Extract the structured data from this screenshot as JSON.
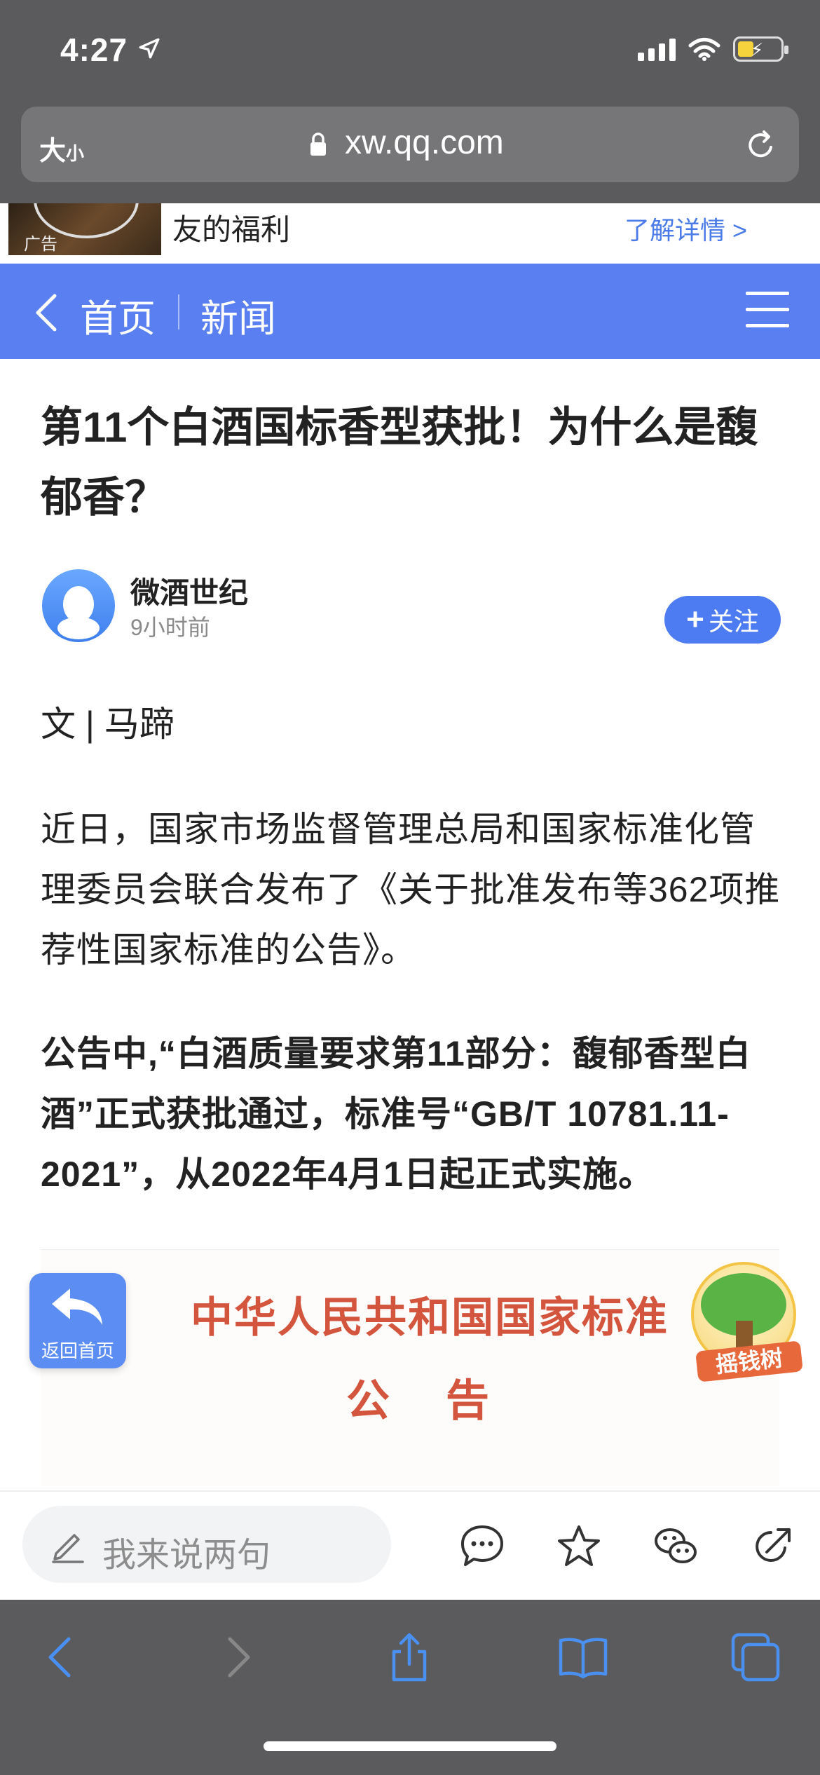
{
  "status_bar": {
    "time": "4:27"
  },
  "browser": {
    "text_size_label": "大",
    "text_size_label_small": "小",
    "url": "xw.qq.com"
  },
  "ad": {
    "tag": "广告",
    "text": "友的福利",
    "link": "了解详情 >"
  },
  "nav": {
    "home": "首页",
    "section": "新闻"
  },
  "article": {
    "title": "第11个白酒国标香型获批！为什么是馥郁香？",
    "author": "微酒世纪",
    "time": "9小时前",
    "follow_icon": "+",
    "follow_label": "关注",
    "byline": "文 | 马蹄",
    "paragraph1": "近日，国家市场监督管理总局和国家标准化管理委员会联合发布了《关于批准发布等362项推荐性国家标准的公告》。",
    "paragraph2": "公告中,“白酒质量要求第11部分：馥郁香型白酒”正式获批通过，标准号“GB/T 10781.11-2021”，从2022年4月1日起正式实施。"
  },
  "notice_image": {
    "line1": "中华人民共和国国家标准",
    "line2": "公告"
  },
  "floating": {
    "return_label": "返回首页",
    "tree_label": "摇钱树"
  },
  "comment": {
    "placeholder": "我来说两句"
  },
  "colors": {
    "nav_blue": "#5a7ff0",
    "follow_blue": "#4d7cf2",
    "link_blue": "#4a7be8",
    "notice_red": "#d4553e",
    "chrome_gray": "#5b5b5d"
  }
}
